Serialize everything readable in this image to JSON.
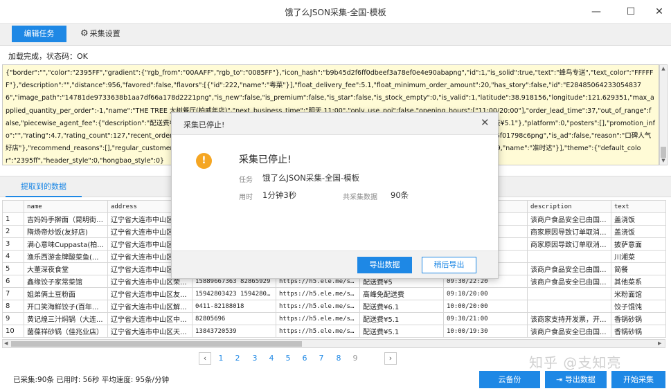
{
  "window": {
    "title": "饿了么JSON采集-全国-模板",
    "minimize": "—",
    "maximize": "☐",
    "close": "✕"
  },
  "toolbar": {
    "edit_tab": "编辑任务",
    "settings_tab": "采集设置"
  },
  "status_line": "加载完成，状态码：OK",
  "json_text": "{\"border\":\"\",\"color\":\"2395FF\",\"gradient\":{\"rgb_from\":\"00AAFF\",\"rgb_to\":\"0085FF\"},\"icon_hash\":\"b9b45d2f6ff0dbeef3a78ef0e4e90abapng\",\"id\":1,\"is_solid\":true,\"text\":\"蜂鸟专送\",\"text_color\":\"FFFFFF\"},\"description\":\"\",\"distance\":956,\"favored\":false,\"flavors\":[{\"id\":222,\"name\":\"粤菜\"}],\"float_delivery_fee\":5.1,\"float_minimum_order_amount\":20,\"has_story\":false,\"id\":\"E284850642330548376\",\"image_path\":\"14781de9733638b1aa7df66a178d2221png\",\"is_new\":false,\"is_premium\":false,\"is_star\":false,\"is_stock_empty\":0,\"is_valid\":1,\"latitude\":38.918156,\"longitude\":121.629351,\"max_applied_quantity_per_order\":-1,\"name\":\"THE TREE 大树餐厅(柏威年店)\",\"next_business_time\":\"明天 11:00\",\"only_use_poi\":false,\"opening_hours\":[\"11:00/20:00\"],\"order_lead_time\":37,\"out_of_range\":false,\"piecewise_agent_fee\":{\"description\":\"配送费¥5.1\",\"extra_fee\":0,\"is_extra\":false,\"no_subsidy_fee\":\"\",\"rules\":[{\"fee\":5.1,\"price\":20}],\"tips\":\"配送费¥5.1\"},\"platform\":0,\"posters\":[],\"promotion_info\":\"\",\"rating\":4.7,\"rating_count\":127,\"recent_order_num\":73,\"recent_food_popularity\":0,\"regular_customer_count\":0,\"restaurant_info\":\"7fd296d3e2d6f01798c6png\",\"is_ad\":false,\"reason\":\"口碑人气好店\"},\"recommend_reasons\":[],\"regular_customer_count\":0,\"rating\":4.7,\"supports\":[{\"border\":\"dddddd\",\"color\":\"666666\",\"icon\":\"4e20966ca2\",\"id\":9,\"name\":\"准时达\"}],\"theme\":{\"default_color\":\"2395ff\",\"header_style\":0,\"hongbao_style\":0}",
  "data_tab": "提取到的数据",
  "table": {
    "columns": [
      "",
      "name",
      "address",
      "phone",
      "url",
      "tips",
      "opening_hours",
      "description",
      "text"
    ],
    "rows": [
      [
        "1",
        "吉妈妈手擀面（昆明街店）",
        "辽宁省大连市中山区",
        "",
        "",
        "",
        "",
        "该商户食品安全已由国...",
        "盖浇饭"
      ],
      [
        "2",
        "隋炀帝炒饭(友好店)",
        "辽宁省大连市中山区",
        "",
        "",
        "",
        "",
        "商家原因导致订单取消...",
        "盖浇饭"
      ],
      [
        "3",
        "满心意味Cuppasta(柏...",
        "辽宁省大连市中山区",
        "",
        "",
        "",
        "",
        "商家原因导致订单取消...",
        "披萨意面"
      ],
      [
        "4",
        "渔乐西游金牌酸菜鱼(...",
        "辽宁省大连市中山区",
        "",
        "",
        "",
        "",
        "",
        "川湘菜"
      ],
      [
        "5",
        "大董深夜食堂",
        "辽宁省大连市中山区",
        "",
        "",
        "",
        "",
        "该商户食品安全已由国...",
        "简餐"
      ],
      [
        "6",
        "鑫缘饺子家常菜馆",
        "辽宁省大连市中山区荣...",
        "15889667363 82865929",
        "https://h5.ele.me/sh...",
        "配送费¥5",
        "09:30/22:20",
        "该商户食品安全已由国...",
        "其他菜系"
      ],
      [
        "7",
        "姐弟俩土豆粉面",
        "辽宁省大连市中山区友...",
        "15942803423 15942803423",
        "https://h5.ele.me/sh...",
        "高峰免配送费",
        "09:10/20:00",
        "",
        "米粉面馆"
      ],
      [
        "8",
        "开口笑海鲜饺子(百年...",
        "辽宁省大连市中山区解...",
        "0411-82188018",
        "https://h5.ele.me/sh...",
        "配送费¥6.1",
        "10:00/20:00",
        "",
        "饺子馄饨"
      ],
      [
        "9",
        "黄记煌三汁焖锅（大连...",
        "辽宁省大连市中山区中...",
        "82805696",
        "https://h5.ele.me/sh...",
        "配送费¥5.1",
        "09:30/21:00",
        "该商家支持开发票，开...",
        "香锅砂锅"
      ],
      [
        "10",
        "菌葆祥砂锅（佳兆业店）",
        "辽宁省大连市中山区天...",
        "13843720539",
        "https://h5.ele.me/sh...",
        "配送费¥5.1",
        "10:00/19:30",
        "该商户食品安全已由国...",
        "香锅砂锅"
      ]
    ]
  },
  "pager": {
    "prev": "‹",
    "next": "›",
    "pages": [
      "1",
      "2",
      "3",
      "4",
      "5",
      "6",
      "7",
      "8",
      "9"
    ]
  },
  "bottom": {
    "status": "已采集:90条  已用时: 56秒 平均速度: 95条/分钟",
    "cloud_backup": "云备份",
    "export_data": "导出数据",
    "start_collect": "开始采集",
    "watermark": "知乎 @支知亮"
  },
  "modal": {
    "title": "采集已停止!",
    "close": "✕",
    "icon_glyph": "!",
    "heading": "采集已停止!",
    "task_label": "任务",
    "task_value": "饿了么JSON采集-全国-模板",
    "time_label": "用时",
    "time_value": "1分钟3秒",
    "total_label": "共采集数据",
    "total_value": "90条",
    "export_now": "导出数据",
    "export_later": "稍后导出"
  },
  "colors": {
    "accent": "#1e88e5",
    "json_bg": "#fffbd6",
    "warning": "#f5a623"
  }
}
